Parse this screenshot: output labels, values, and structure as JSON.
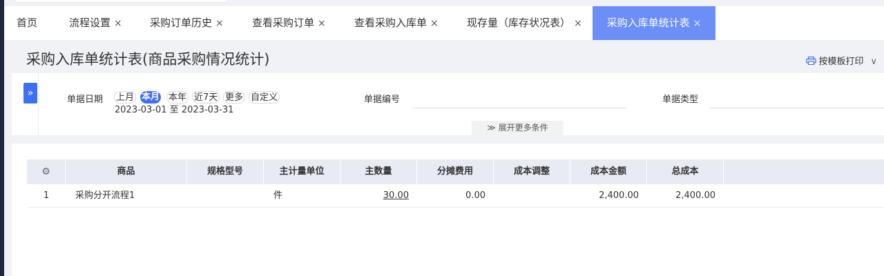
{
  "tabs": [
    {
      "label": "首页",
      "close": ""
    },
    {
      "label": "流程设置",
      "close": "×"
    },
    {
      "label": "采购订单历史",
      "close": "×"
    },
    {
      "label": "查看采购订单",
      "close": "×"
    },
    {
      "label": "查看采购入库单",
      "close": "×"
    },
    {
      "label": "现存量（库存状况表）",
      "close": "×"
    },
    {
      "label": "采购入库单统计表",
      "close": "×"
    }
  ],
  "page": {
    "title": "采购入库单统计表(商品采购情况统计)",
    "print_label": "按模板打印",
    "print_icon": "printer-icon",
    "chevron": "∨"
  },
  "filters": {
    "toggle_glyph": "»",
    "date_label": "单据日期",
    "date_options": [
      "上月",
      "本月",
      "本年",
      "近7天",
      "更多",
      "自定义"
    ],
    "date_selected": "本月",
    "date_range": "2023-03-01 至 2023-03-31",
    "doc_no_label": "单据编号",
    "doc_no_value": "",
    "doc_type_label": "单据类型",
    "doc_type_value": "",
    "more_label": "≫ 展开更多条件"
  },
  "table": {
    "settings_icon": "gear-icon",
    "settings_glyph": "⚙",
    "columns": [
      "商品",
      "规格型号",
      "主计量单位",
      "主数量",
      "分摊费用",
      "成本调整",
      "成本金额",
      "总成本"
    ],
    "rows": [
      {
        "index": "1",
        "product": "采购分开流程1",
        "spec": "",
        "unit": "件",
        "qty": "30.00",
        "alloc": "0.00",
        "adjust": "",
        "cost": "2,400.00",
        "total": "2,400.00"
      }
    ]
  },
  "colors": {
    "accent": "#3e6ff7",
    "active_tab": "#6b8ef7",
    "header_bg": "#e9ebf3",
    "sidebar_dark": "#1f2740"
  }
}
